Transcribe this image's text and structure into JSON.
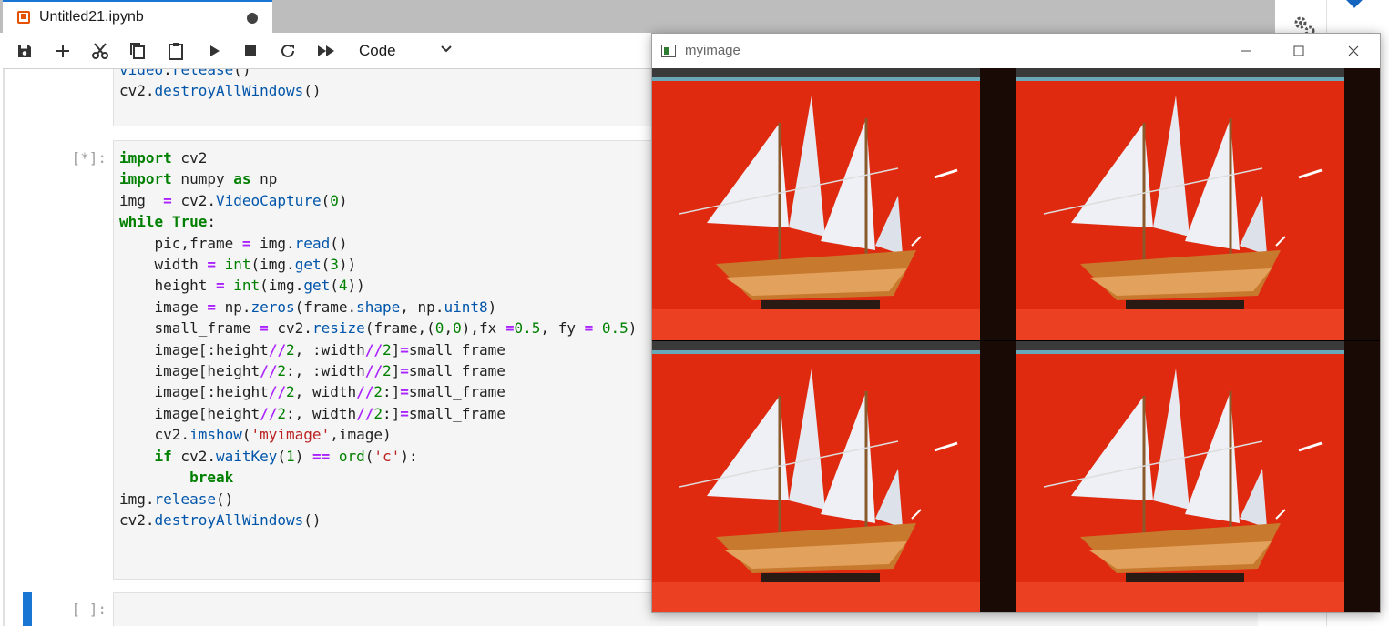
{
  "tab": {
    "title": "Untitled21.ipynb"
  },
  "toolbar": {
    "cell_type": "Code",
    "buttons": [
      "save-icon",
      "add-icon",
      "cut-icon",
      "copy-icon",
      "paste-icon",
      "run-icon",
      "stop-icon",
      "restart-icon",
      "fast-forward-icon"
    ]
  },
  "cells": [
    {
      "prompt": "",
      "lines": [
        "video.release()",
        "cv2.destroyAllWindows()"
      ]
    },
    {
      "prompt": "[*]:",
      "lines": [
        "import cv2",
        "import numpy as np",
        "img  = cv2.VideoCapture(0)",
        "while True:",
        "    pic,frame = img.read()",
        "    width = int(img.get(3))",
        "    height = int(img.get(4))",
        "    image = np.zeros(frame.shape, np.uint8)",
        "    small_frame = cv2.resize(frame,(0,0),fx =0.5, fy = 0.5)",
        "    image[:height//2, :width//2]=small_frame",
        "    image[height//2:, :width//2]=small_frame",
        "    image[:height//2, width//2:]=small_frame",
        "    image[height//2:, width//2:]=small_frame",
        "    cv2.imshow('myimage',image)",
        "    if cv2.waitKey(1) == ord('c'):",
        "        break",
        "img.release()",
        "cv2.destroyAllWindows()"
      ]
    },
    {
      "prompt": "[ ]:",
      "lines": []
    }
  ],
  "cv_window": {
    "title": "myimage",
    "controls": [
      "minimize-icon",
      "maximize-icon",
      "close-icon"
    ],
    "colors": {
      "background": "#e02a10",
      "sail": "#eef0f5",
      "hull": "#c77a2e"
    }
  }
}
